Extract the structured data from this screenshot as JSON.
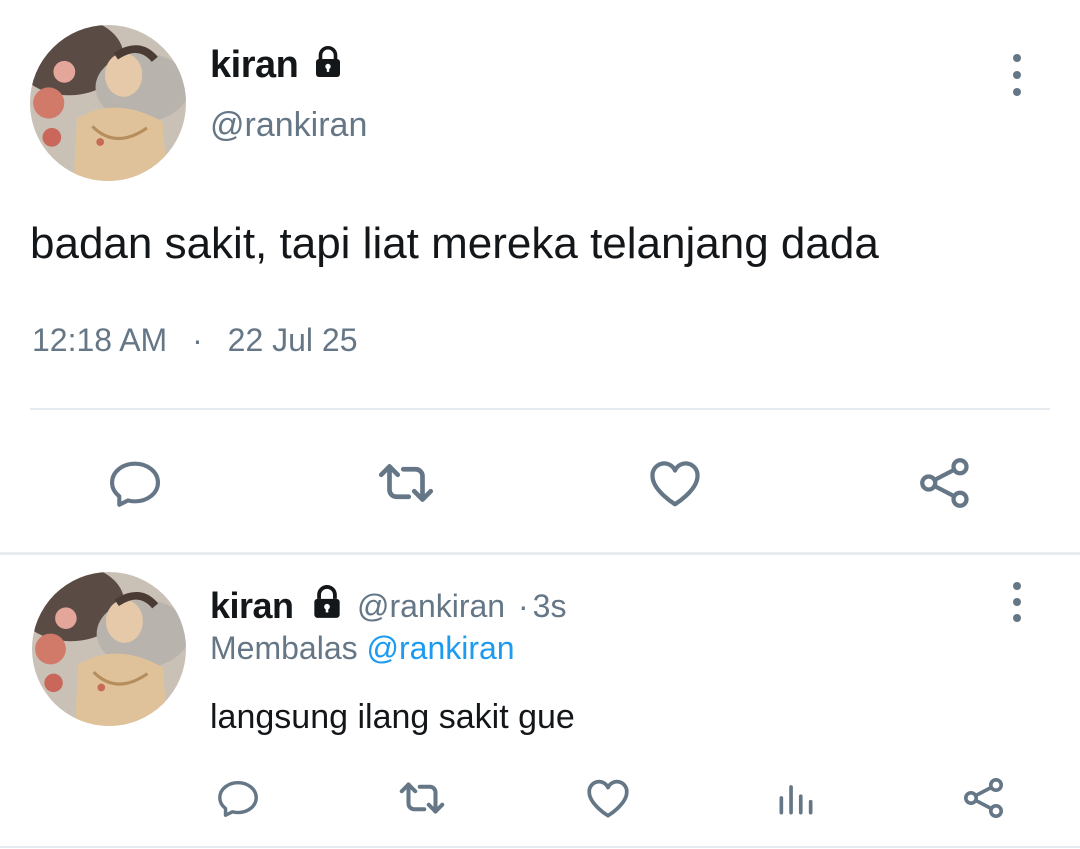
{
  "main_tweet": {
    "display_name": "kiran",
    "handle": "@rankiran",
    "text": "badan sakit, tapi liat mereka telanjang dada",
    "time": "12:18 AM",
    "separator": "·",
    "date": "22 Jul 25",
    "avatar_icon": "avatar-illustration",
    "protected_icon": "lock-icon"
  },
  "main_actions": [
    {
      "name": "reply",
      "icon": "reply-icon"
    },
    {
      "name": "retweet",
      "icon": "retweet-icon"
    },
    {
      "name": "like",
      "icon": "heart-icon"
    },
    {
      "name": "share",
      "icon": "share-icon"
    }
  ],
  "reply_tweet": {
    "display_name": "kiran",
    "handle": "@rankiran",
    "time_sep": "·",
    "age": "3s",
    "replying_label": "Membalas",
    "replying_to": "@rankiran",
    "text": "langsung ilang sakit gue"
  },
  "reply_actions": [
    {
      "name": "reply",
      "icon": "reply-icon"
    },
    {
      "name": "retweet",
      "icon": "retweet-icon"
    },
    {
      "name": "like",
      "icon": "heart-icon"
    },
    {
      "name": "analytics",
      "icon": "analytics-icon"
    },
    {
      "name": "share",
      "icon": "share-icon"
    }
  ],
  "colors": {
    "text": "#14171a",
    "secondary": "#657786",
    "link": "#1d9bf0",
    "divider": "#e6ecf0"
  }
}
